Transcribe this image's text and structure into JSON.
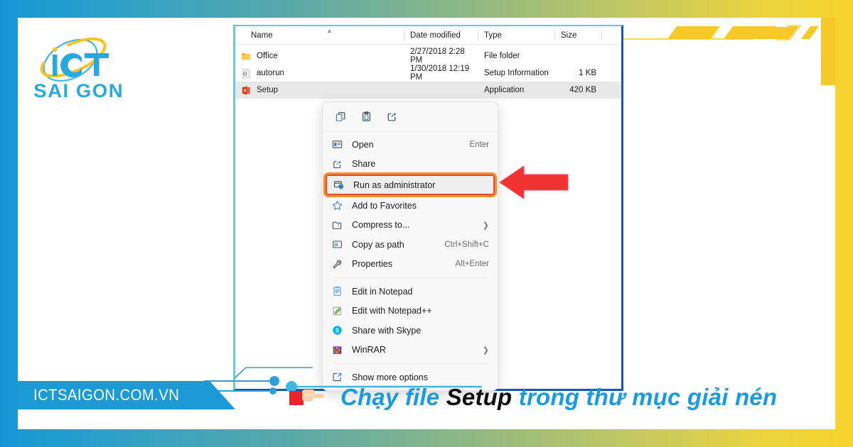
{
  "brand": {
    "logo_primary": "iCT",
    "logo_secondary": "SAI GON",
    "watermark": "ICTSAIGON.COM.VN",
    "accent_blue": "#1a9ae0",
    "accent_yellow": "#f7c928",
    "accent_red": "#f0332e"
  },
  "explorer": {
    "columns": [
      {
        "label": "Name"
      },
      {
        "label": "Date modified"
      },
      {
        "label": "Type"
      },
      {
        "label": "Size"
      }
    ],
    "files": [
      {
        "name": "Office",
        "date_modified": "2/27/2018 2:28 PM",
        "type": "File folder",
        "size": "",
        "icon": "folder-icon",
        "selected": false
      },
      {
        "name": "autorun",
        "date_modified": "1/30/2018 12:19 PM",
        "type": "Setup Information",
        "size": "1 KB",
        "icon": "setup-information-icon",
        "selected": false
      },
      {
        "name": "Setup",
        "date_modified": "",
        "type": "Application",
        "size": "420 KB",
        "icon": "office-application-icon",
        "selected": true
      }
    ]
  },
  "context_menu": {
    "toolbar": [
      {
        "icon": "copy-icon",
        "label": "Copy"
      },
      {
        "icon": "paste-icon",
        "label": "Paste"
      },
      {
        "icon": "share-icon",
        "label": "Share"
      }
    ],
    "groups": [
      {
        "items": [
          {
            "icon": "open-icon",
            "label": "Open",
            "accelerator": "Enter",
            "submenu": false,
            "highlighted": false
          },
          {
            "icon": "share-icon",
            "label": "Share",
            "accelerator": "",
            "submenu": false,
            "highlighted": false
          },
          {
            "icon": "shield-icon",
            "label": "Run as administrator",
            "accelerator": "",
            "submenu": false,
            "highlighted": true
          },
          {
            "icon": "star-icon",
            "label": "Add to Favorites",
            "accelerator": "",
            "submenu": false,
            "highlighted": false
          },
          {
            "icon": "compress-icon",
            "label": "Compress to...",
            "accelerator": "",
            "submenu": true,
            "highlighted": false
          },
          {
            "icon": "copy-path-icon",
            "label": "Copy as path",
            "accelerator": "Ctrl+Shift+C",
            "submenu": false,
            "highlighted": false
          },
          {
            "icon": "properties-icon",
            "label": "Properties",
            "accelerator": "Alt+Enter",
            "submenu": false,
            "highlighted": false
          }
        ]
      },
      {
        "items": [
          {
            "icon": "notepad-icon",
            "label": "Edit in Notepad",
            "accelerator": "",
            "submenu": false,
            "highlighted": false
          },
          {
            "icon": "notepadpp-icon",
            "label": "Edit with Notepad++",
            "accelerator": "",
            "submenu": false,
            "highlighted": false
          },
          {
            "icon": "skype-icon",
            "label": "Share with Skype",
            "accelerator": "",
            "submenu": false,
            "highlighted": false
          },
          {
            "icon": "winrar-icon",
            "label": "WinRAR",
            "accelerator": "",
            "submenu": true,
            "highlighted": false
          }
        ]
      },
      {
        "items": [
          {
            "icon": "show-more-options-icon",
            "label": "Show more options",
            "accelerator": "",
            "submenu": false,
            "highlighted": false
          }
        ]
      }
    ]
  },
  "caption": {
    "prefix": "Chạy file ",
    "keyword": "Setup",
    "suffix": " trong thư mục giải nén",
    "pointer_icon": "pointing-hand-icon"
  },
  "annotation": {
    "arrow_icon": "left-arrow-icon",
    "arrow_color": "#f0332e",
    "highlight_border_inner": "#e84a2e",
    "highlight_border_outer": "#f0902a"
  }
}
